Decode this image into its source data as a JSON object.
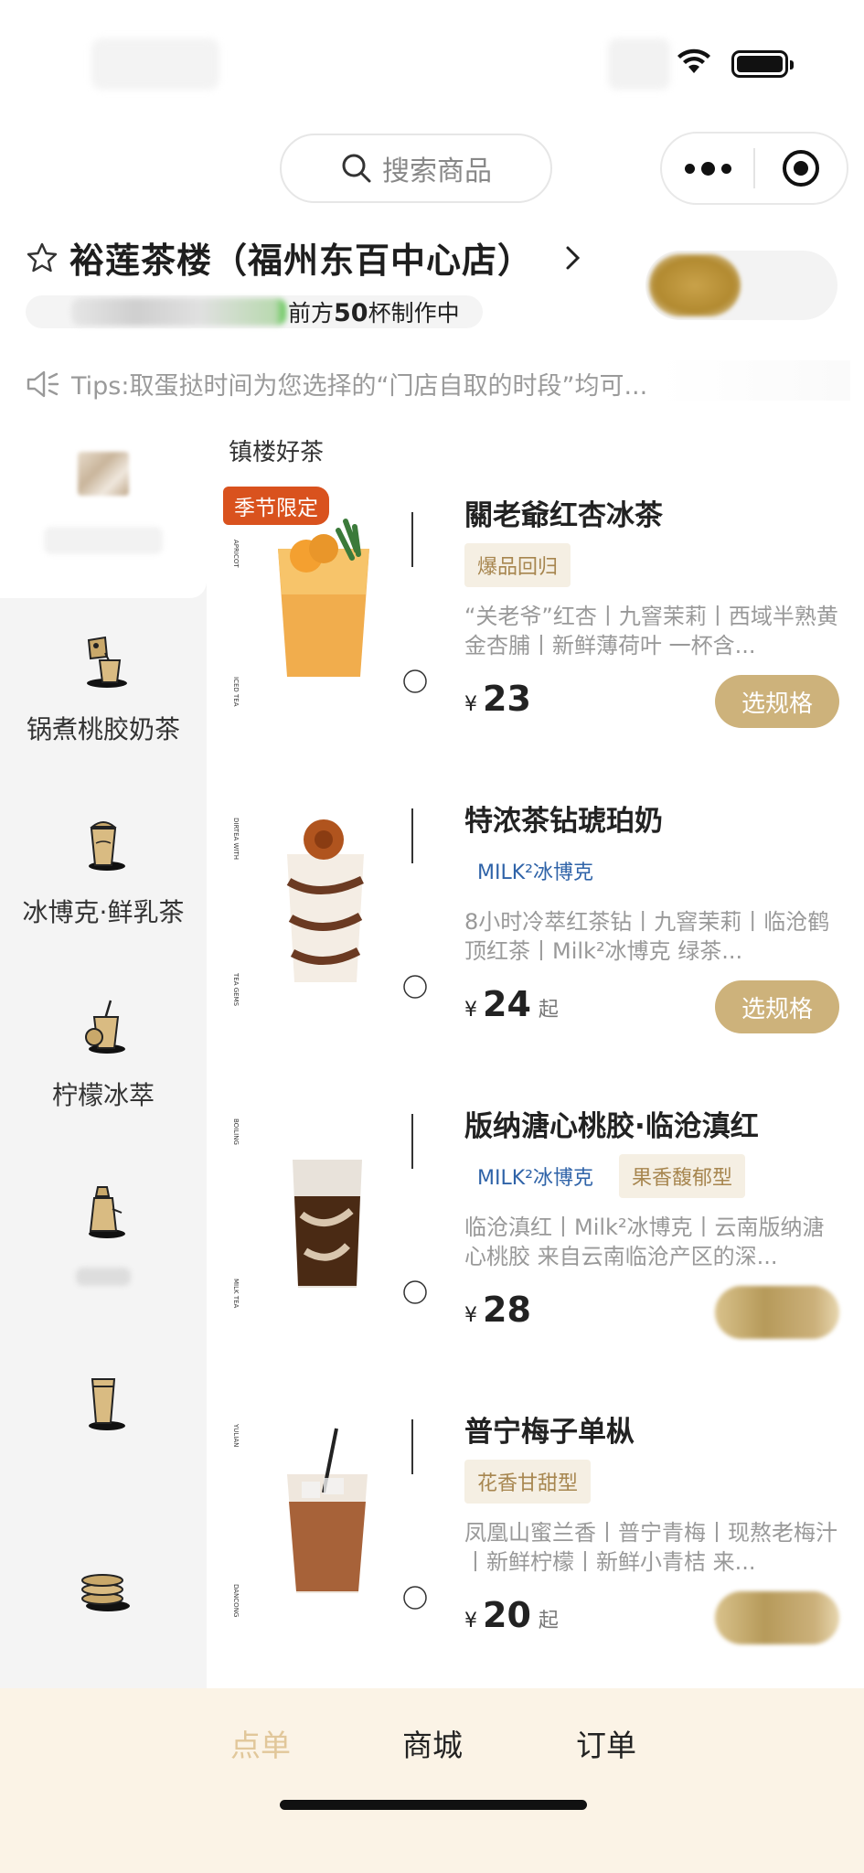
{
  "search": {
    "placeholder": "搜索商品"
  },
  "store": {
    "name": "裕莲茶楼（福州东百中心店）",
    "queue_prefix": "前方",
    "queue_count": "50",
    "queue_suffix": "杯制作中"
  },
  "tips": {
    "text": "Tips:取蛋挞时间为您选择的“门店自取的时段”均可..."
  },
  "sidebar": {
    "items": [
      {
        "label": "",
        "icon": "blurred-thumbnail"
      },
      {
        "label": "锅煮桃胶奶茶",
        "icon": "pot-tea-icon"
      },
      {
        "label": "冰博克·鲜乳茶",
        "icon": "milk-tea-icon"
      },
      {
        "label": "柠檬冰萃",
        "icon": "lemon-tea-icon"
      },
      {
        "label": "",
        "icon": "shaker-icon"
      },
      {
        "label": "",
        "icon": "cup-icon"
      },
      {
        "label": "",
        "icon": "stack-icon"
      }
    ]
  },
  "section_title": "镇楼好茶",
  "products": [
    {
      "name": "關老爺红杏冰茶",
      "season_tag": "季节限定",
      "tags": [
        {
          "text": "爆品回归",
          "style": "tan"
        }
      ],
      "desc": "“关老爷”红杏丨九窨茉莉丨西域半熟黄金杏脯丨新鲜薄荷叶 一杯含...",
      "price": "23",
      "qi": "",
      "button": "选规格"
    },
    {
      "name": "特浓茶钻琥珀奶",
      "season_tag": "",
      "tags": [
        {
          "text": "MILK²冰博克",
          "style": "blue"
        }
      ],
      "desc": "8小时冷萃红茶钻丨九窨茉莉丨临沧鹤顶红茶丨Milk²冰博克 绿茶...",
      "price": "24",
      "qi": "起",
      "button": "选规格"
    },
    {
      "name": "版纳溏心桃胶·临沧滇红",
      "season_tag": "",
      "tags": [
        {
          "text": "MILK²冰博克",
          "style": "blue"
        },
        {
          "text": "果香馥郁型",
          "style": "tan"
        }
      ],
      "desc": "临沧滇红丨Milk²冰博克丨云南版纳溏心桃胶 来自云南临沧产区的深...",
      "price": "28",
      "qi": "",
      "button": ""
    },
    {
      "name": "普宁梅子单枞",
      "season_tag": "",
      "tags": [
        {
          "text": "花香甘甜型",
          "style": "tan"
        }
      ],
      "desc": "凤凰山蜜兰香丨普宁青梅丨现熬老梅汁丨新鲜柠檬丨新鲜小青桔 来...",
      "price": "20",
      "qi": "起",
      "button": ""
    }
  ],
  "currency": "¥",
  "tabbar": {
    "order": "点单",
    "mall": "商城",
    "orders": "订单"
  },
  "colors": {
    "accent": "#cdb27b",
    "season_tag": "#d9521e",
    "tab_active": "#e1c79a",
    "tabbar_bg": "#fbf3e6",
    "tag_blue": "#2f63a8"
  }
}
